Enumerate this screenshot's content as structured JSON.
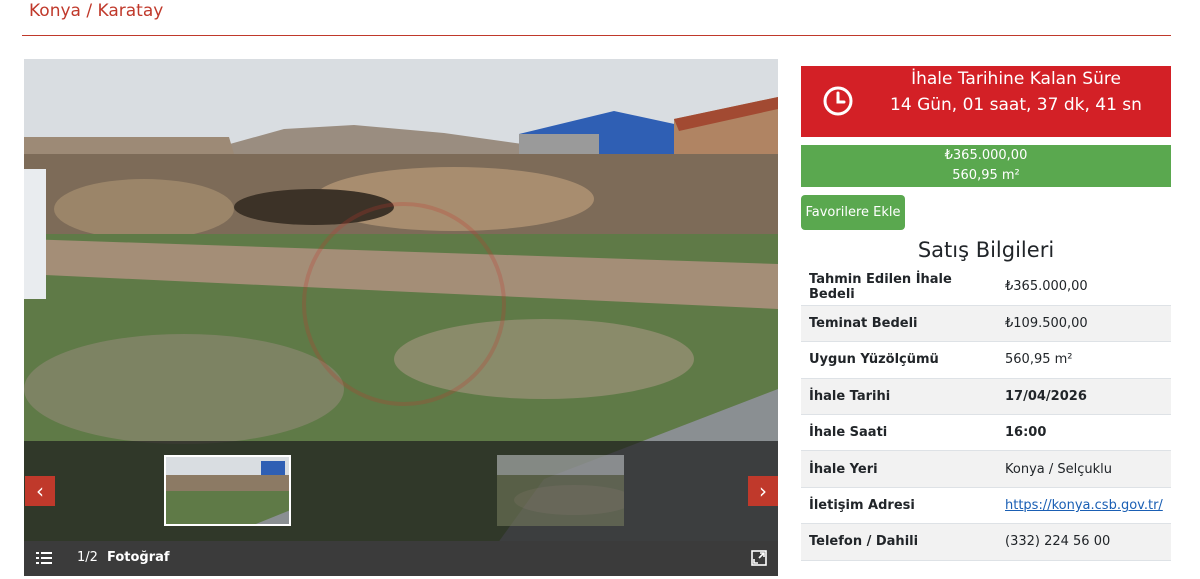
{
  "header": {
    "location": "Konya / Karatay"
  },
  "gallery": {
    "counter": "1/2",
    "type_label": "Fotoğraf",
    "prev_glyph": "‹",
    "next_glyph": "›"
  },
  "countdown": {
    "label": "İhale Tarihine Kalan Süre",
    "value": "14 Gün, 01 saat, 37 dk, 41 sn",
    "color": "#d32026"
  },
  "price": {
    "amount": "₺365.000,00",
    "area": "560,95 m²",
    "color": "#5aa84f"
  },
  "favorite_button": "Favorilere Ekle",
  "sale_info": {
    "title": "Satış Bilgileri",
    "rows": [
      {
        "label": "Tahmin Edilen İhale Bedeli",
        "value": "₺365.000,00"
      },
      {
        "label": "Teminat Bedeli",
        "value": "₺109.500,00"
      },
      {
        "label": "Uygun Yüzölçümü",
        "value": "560,95 m²"
      },
      {
        "label": "İhale Tarihi",
        "value": "17/04/2026"
      },
      {
        "label": "İhale Saati",
        "value": "16:00"
      },
      {
        "label": "İhale Yeri",
        "value": "Konya / Selçuklu"
      },
      {
        "label": "İletişim Adresi",
        "value": "https://konya.csb.gov.tr/"
      },
      {
        "label": "Telefon / Dahili",
        "value": "(332) 224 56 00"
      }
    ]
  },
  "icons": {
    "clock": "clock-icon",
    "menu": "list-icon",
    "expand": "expand-icon",
    "prev": "chevron-left-icon",
    "next": "chevron-right-icon"
  }
}
